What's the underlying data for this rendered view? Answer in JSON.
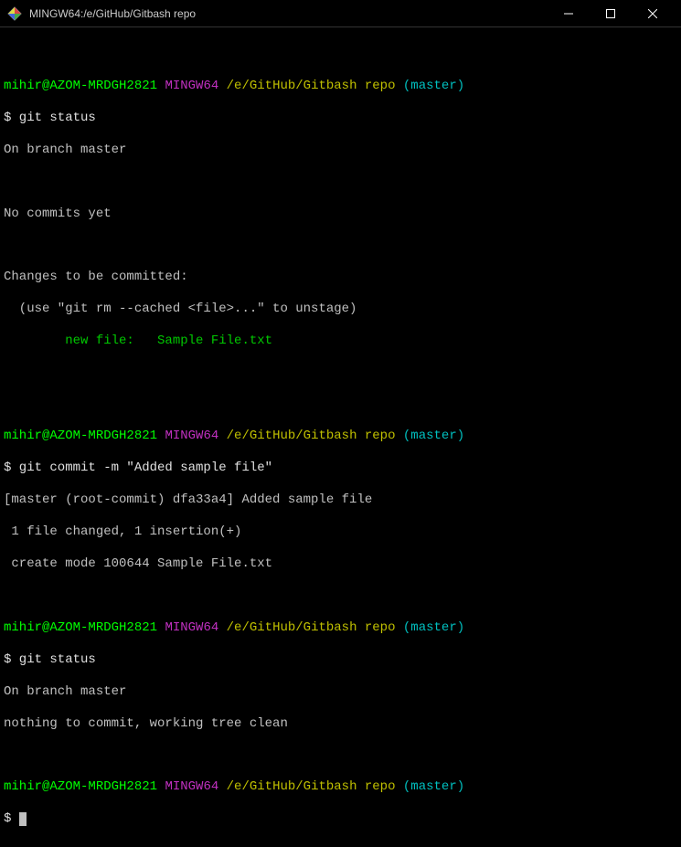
{
  "window": {
    "title": "MINGW64:/e/GitHub/Gitbash repo"
  },
  "prompts": [
    {
      "user": "mihir@AZOM-MRDGH2821",
      "env": "MINGW64",
      "path": "/e/GitHub/Gitbash repo",
      "branch": "(master)"
    },
    {
      "user": "mihir@AZOM-MRDGH2821",
      "env": "MINGW64",
      "path": "/e/GitHub/Gitbash repo",
      "branch": "(master)"
    },
    {
      "user": "mihir@AZOM-MRDGH2821",
      "env": "MINGW64",
      "path": "/e/GitHub/Gitbash repo",
      "branch": "(master)"
    },
    {
      "user": "mihir@AZOM-MRDGH2821",
      "env": "MINGW64",
      "path": "/e/GitHub/Gitbash repo",
      "branch": "(master)"
    }
  ],
  "commands": {
    "c1": "$ git status",
    "c2": "$ git commit -m \"Added sample file\"",
    "c3": "$ git status",
    "c4": "$ "
  },
  "output": {
    "block1": {
      "l1": "On branch master",
      "l2": "No commits yet",
      "l3": "Changes to be committed:",
      "l4": "  (use \"git rm --cached <file>...\" to unstage)",
      "l5": "        new file:   Sample File.txt"
    },
    "block2": {
      "l1": "[master (root-commit) dfa33a4] Added sample file",
      "l2": " 1 file changed, 1 insertion(+)",
      "l3": " create mode 100644 Sample File.txt"
    },
    "block3": {
      "l1": "On branch master",
      "l2": "nothing to commit, working tree clean"
    }
  }
}
